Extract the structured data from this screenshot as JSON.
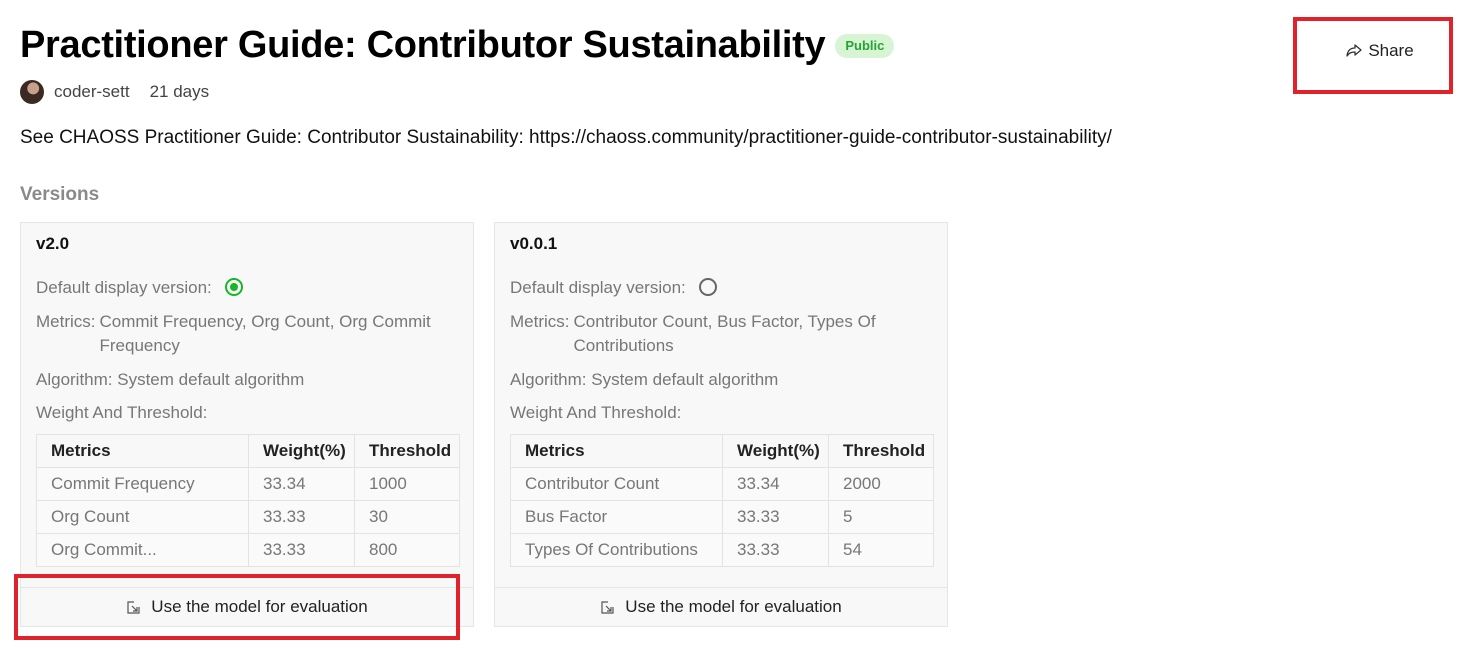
{
  "header": {
    "title": "Practitioner Guide: Contributor Sustainability",
    "badge": "Public",
    "author": "coder-sett",
    "age": "21 days",
    "share_label": "Share"
  },
  "description": "See CHAOSS Practitioner Guide: Contributor Sustainability: https://chaoss.community/practitioner-guide-contributor-sustainability/",
  "versions_heading": "Versions",
  "labels": {
    "default_display": "Default display version",
    "colon": ":",
    "metrics": "Metrics:",
    "weight_threshold": "Weight And Threshold:",
    "use_model": "Use the model for evaluation",
    "col_metrics": "Metrics",
    "col_weight": "Weight(%)",
    "col_threshold": "Threshold"
  },
  "versions": [
    {
      "name": "v2.0",
      "default_selected": true,
      "metrics": "Commit Frequency, Org Count, Org Commit Frequency",
      "algorithm": "Algorithm: System default algorithm",
      "rows": [
        {
          "metric": "Commit Frequency",
          "weight": "33.34",
          "threshold": "1000"
        },
        {
          "metric": "Org Count",
          "weight": "33.33",
          "threshold": "30"
        },
        {
          "metric": "Org Commit...",
          "weight": "33.33",
          "threshold": "800"
        }
      ]
    },
    {
      "name": "v0.0.1",
      "default_selected": false,
      "metrics": "Contributor Count, Bus Factor, Types Of Contributions",
      "algorithm": "Algorithm: System default algorithm",
      "rows": [
        {
          "metric": "Contributor Count",
          "weight": "33.34",
          "threshold": "2000"
        },
        {
          "metric": "Bus Factor",
          "weight": "33.33",
          "threshold": "5"
        },
        {
          "metric": "Types Of Contributions",
          "weight": "33.33",
          "threshold": "54"
        }
      ]
    }
  ],
  "colors": {
    "accent_green": "#18b52a",
    "highlight_red": "#e0222b",
    "badge_bg": "#d7f5d5"
  }
}
